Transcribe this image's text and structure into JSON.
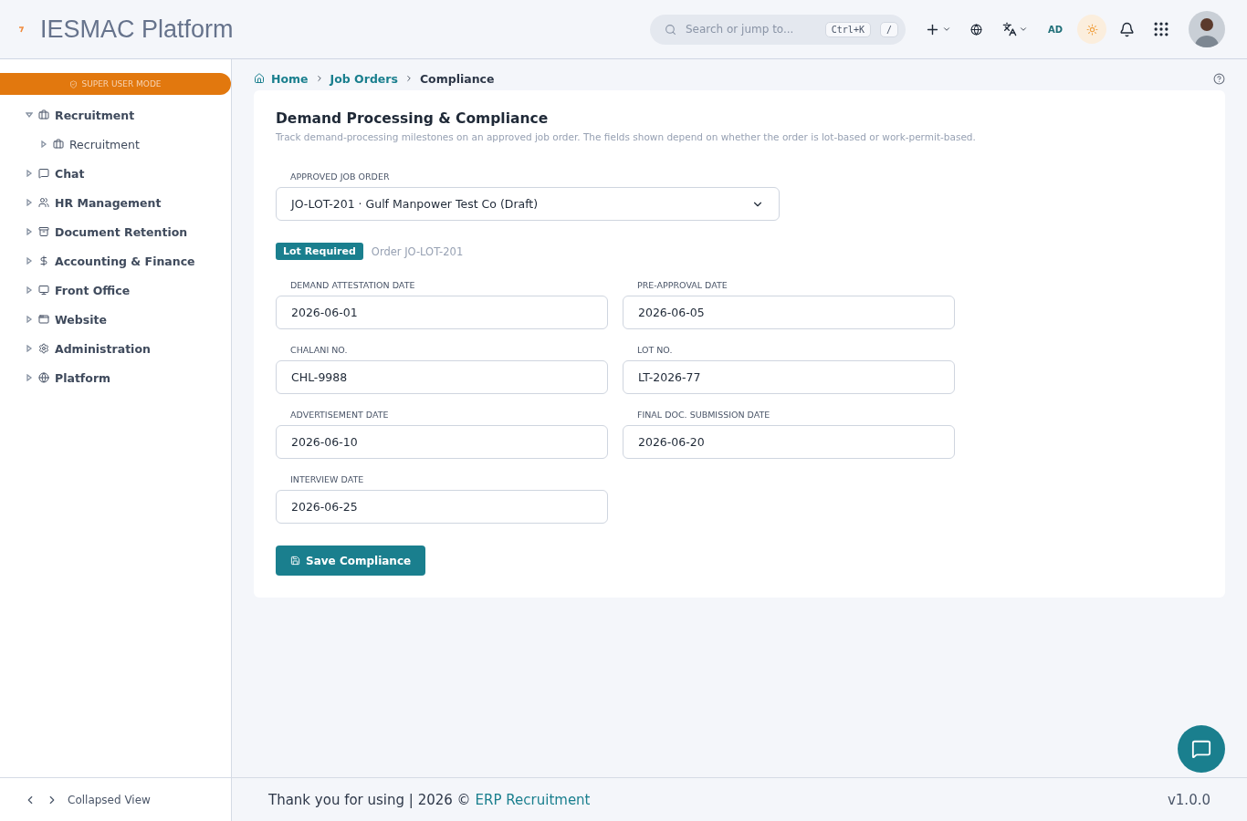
{
  "header": {
    "title": "IESMAC Platform",
    "search": {
      "placeholder": "Search or jump to...",
      "shortcut": "Ctrl+K",
      "slash": "/"
    },
    "user_initials": "AD"
  },
  "sidebar": {
    "mode_banner": "SUPER USER MODE",
    "items": [
      {
        "label": "Recruitment",
        "expanded": true,
        "children": [
          {
            "label": "Recruitment",
            "expanded": false
          }
        ]
      },
      {
        "label": "Chat",
        "expanded": false
      },
      {
        "label": "HR Management",
        "expanded": false
      },
      {
        "label": "Document Retention",
        "expanded": false
      },
      {
        "label": "Accounting & Finance",
        "expanded": false
      },
      {
        "label": "Front Office",
        "expanded": false
      },
      {
        "label": "Website",
        "expanded": false
      },
      {
        "label": "Administration",
        "expanded": false
      },
      {
        "label": "Platform",
        "expanded": false
      }
    ],
    "collapse_label": "Collapsed View"
  },
  "breadcrumb": [
    {
      "label": "Home",
      "link": true
    },
    {
      "label": "Job Orders",
      "link": true
    },
    {
      "label": "Compliance",
      "link": false
    }
  ],
  "card": {
    "title": "Demand Processing & Compliance",
    "subtitle": "Track demand-processing milestones on an approved job order. The fields shown depend on whether the order is lot-based or work-permit-based.",
    "job_order": {
      "label": "APPROVED JOB ORDER",
      "value": "JO-LOT-201 · Gulf Manpower Test Co (Draft)"
    },
    "badge": "Lot Required",
    "order_ref": "Order JO-LOT-201",
    "fields": [
      {
        "label": "DEMAND ATTESTATION DATE",
        "value": "2026-06-01"
      },
      {
        "label": "PRE-APPROVAL DATE",
        "value": "2026-06-05"
      },
      {
        "label": "CHALANI NO.",
        "value": "CHL-9988"
      },
      {
        "label": "LOT NO.",
        "value": "LT-2026-77"
      },
      {
        "label": "ADVERTISEMENT DATE",
        "value": "2026-06-10"
      },
      {
        "label": "FINAL DOC. SUBMISSION DATE",
        "value": "2026-06-20"
      },
      {
        "label": "INTERVIEW DATE",
        "value": "2026-06-25"
      }
    ],
    "save_button": "Save Compliance"
  },
  "footer": {
    "text": "Thank you for using | 2026 © ",
    "link": "ERP Recruitment",
    "version": "v1.0.0"
  }
}
